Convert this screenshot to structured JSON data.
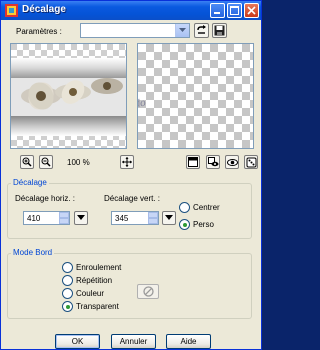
{
  "window": {
    "title": "Décalage",
    "controls": {
      "minimize_icon": "minimize-icon",
      "maximize_icon": "maximize-icon",
      "close_icon": "close-icon"
    }
  },
  "presets": {
    "label": "Paramètres :",
    "value": ""
  },
  "preview": {
    "watermark": "© Les douceurs de Clodo"
  },
  "zoom": {
    "level": "100 %"
  },
  "decalage": {
    "group_title": "Décalage",
    "horiz_label": "Décalage horiz. :",
    "horiz_value": "410",
    "vert_label": "Décalage vert. :",
    "vert_value": "345",
    "options": [
      {
        "label": "Centrer",
        "selected": false
      },
      {
        "label": "Perso",
        "selected": true
      }
    ]
  },
  "mode_bord": {
    "group_title": "Mode Bord",
    "options": [
      {
        "label": "Enroulement",
        "selected": false
      },
      {
        "label": "Répétition",
        "selected": false
      },
      {
        "label": "Couleur",
        "selected": false
      },
      {
        "label": "Transparent",
        "selected": true
      }
    ]
  },
  "buttons": {
    "ok": "OK",
    "cancel": "Annuler",
    "help": "Aide"
  },
  "colors": {
    "title_bar": "#0a5ae0",
    "group_title": "#0046d5",
    "dialog_bg": "#ece9d8"
  }
}
